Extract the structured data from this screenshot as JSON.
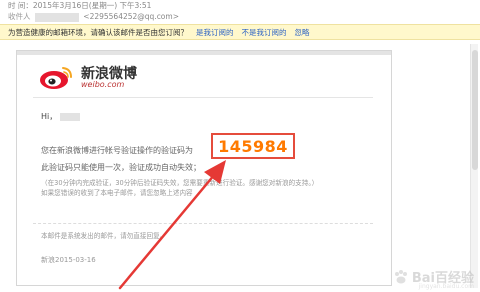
{
  "meta": {
    "time_line": "时   间：2015年3月16日(星期一) 下午3:51",
    "recipient_label": "收件人",
    "recipient_email": "<2295564252@qq.com>"
  },
  "safety_bar": {
    "message": "为营造健康的邮箱环境，请确认该邮件是否由您订阅？",
    "links": [
      "是我订阅的",
      "不是我订阅的",
      "忽略"
    ]
  },
  "email": {
    "brand_cn": "新浪微博",
    "brand_en": "weibo.com",
    "greeting": "Hi，",
    "line1": "您在新浪微博进行帐号验证操作的验证码为",
    "code": "145984",
    "line2": "此验证码只能使用一次，验证成功自动失效；",
    "note1": "（在30分钟内完成验证，30分钟后验证码失效，您需要重新进行验证。感谢您对新浪的支持。）",
    "note2": "如果您错误的收到了本电子邮件，请您忽略上述内容",
    "footer": "本邮件是系统发出的邮件，请勿直接回复。",
    "signature": "新浪2015-03-16"
  },
  "colors": {
    "code": "#ff7a00",
    "highlight_box": "#e54c3c",
    "arrow": "#e53935",
    "safety_bg": "#fff8cc",
    "link": "#2c62c4"
  },
  "watermark": {
    "text": "Bai百经验",
    "sub": "jingyan.baidu.com"
  }
}
